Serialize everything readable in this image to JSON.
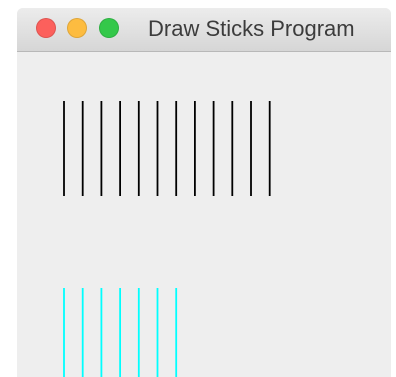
{
  "window": {
    "title": "Draw Sticks Program",
    "buttons": {
      "close_color": "#fc605c",
      "minimize_color": "#fdbc40",
      "zoom_color": "#34c84a"
    }
  },
  "canvas": {
    "background": "#eeeeee",
    "stick_groups": [
      {
        "name": "black-sticks",
        "color": "#000000",
        "count": 12
      },
      {
        "name": "cyan-sticks",
        "color": "#00ffff",
        "count": 7
      }
    ]
  }
}
